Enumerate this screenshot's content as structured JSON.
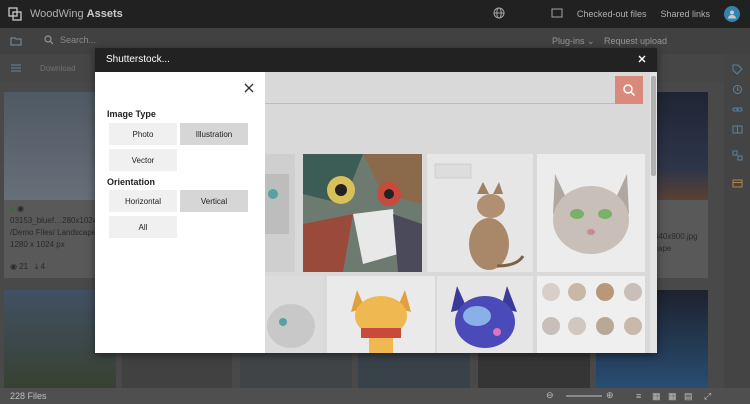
{
  "app": {
    "brand_light": "WoodWing ",
    "brand_bold": "Assets",
    "nav_checked_out": "Checked-out files",
    "nav_shared_links": "Shared links"
  },
  "searchbar": {
    "placeholder": "Search...",
    "plugins": "Plug-ins",
    "request_upload": "Request upload"
  },
  "toolbar": {
    "download": "Download"
  },
  "grid": {
    "tile_name": "03153_bluef…280x1024",
    "tile_path": "/Demo Files/ Landscape",
    "tile_size": "1280 x 1024 px",
    "tile_views": "21",
    "tile_downloads": "4",
    "tile2_name": "440x900.jpg",
    "tile2_path": "cape"
  },
  "status": {
    "files": "228 Files"
  },
  "dialog": {
    "title": "Shutterstock...",
    "image_type_label": "Image Type",
    "image_types": [
      {
        "label": "Photo",
        "selected": false
      },
      {
        "label": "Illustration",
        "selected": true
      },
      {
        "label": "Vector",
        "selected": false
      }
    ],
    "orientation_label": "Orientation",
    "orientations": [
      {
        "label": "Horizontal",
        "selected": false
      },
      {
        "label": "Vertical",
        "selected": true
      },
      {
        "label": "All",
        "selected": false
      }
    ]
  },
  "colors": {
    "topbar": "#1f1f1f",
    "search_button": "#d98a7c",
    "selected_option": "#d6d6d6"
  }
}
